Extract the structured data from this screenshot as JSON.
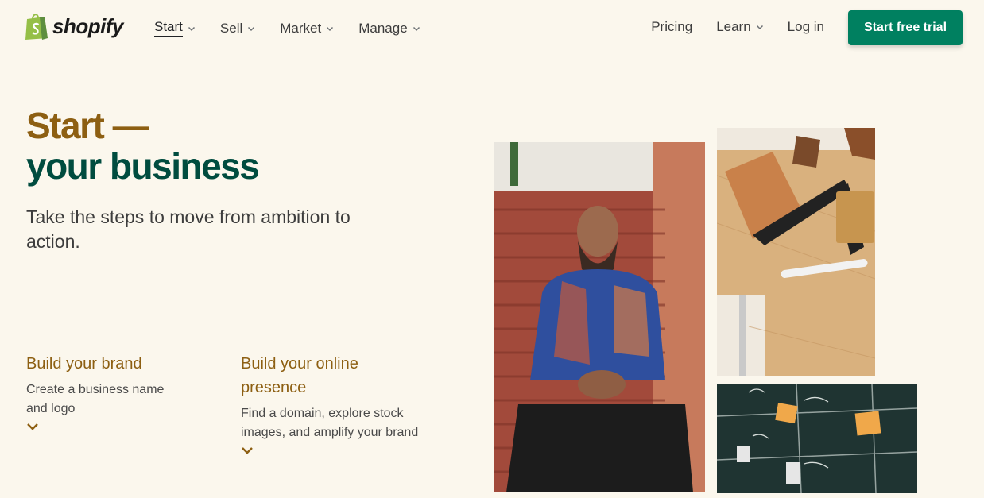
{
  "header": {
    "logo_text": "shopify",
    "nav_left": [
      {
        "label": "Start",
        "active": true
      },
      {
        "label": "Sell",
        "active": false
      },
      {
        "label": "Market",
        "active": false
      },
      {
        "label": "Manage",
        "active": false
      }
    ],
    "nav_right": {
      "pricing": "Pricing",
      "learn": "Learn",
      "login": "Log in"
    },
    "cta": "Start free trial"
  },
  "hero": {
    "title_line1": "Start —",
    "title_line2": "your business",
    "subtitle": "Take the steps to move from ambition to action."
  },
  "features": [
    {
      "title": "Build your brand",
      "description": "Create a business name and logo"
    },
    {
      "title": "Build your online presence",
      "description": "Find a domain, explore stock images, and amplify your brand"
    }
  ],
  "colors": {
    "background": "#fbf7ed",
    "accent_gold": "#8d5f12",
    "accent_green": "#004c3f",
    "cta_green": "#008060"
  }
}
